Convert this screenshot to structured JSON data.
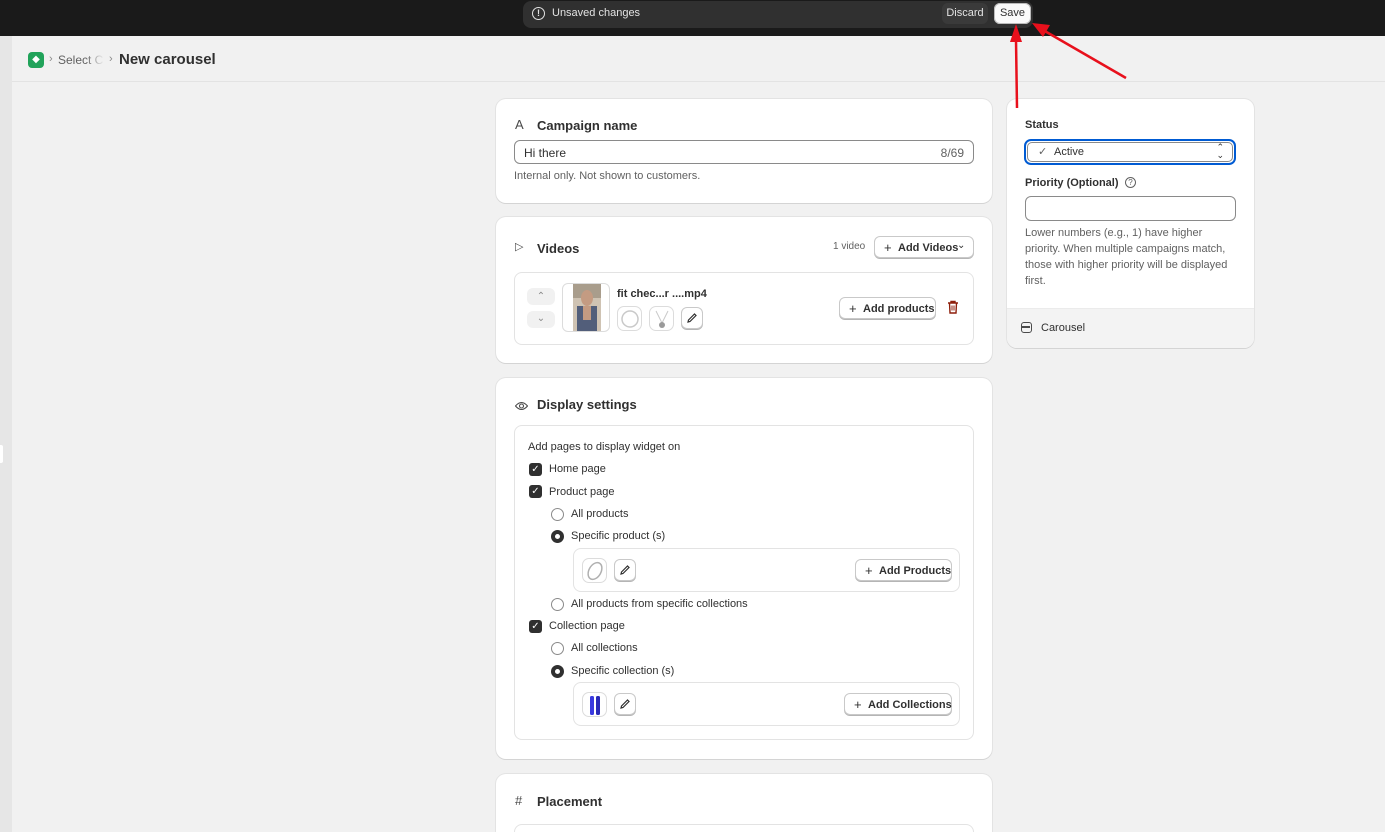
{
  "contextual_bar": {
    "message": "Unsaved changes",
    "discard_label": "Discard",
    "save_label": "Save"
  },
  "header": {
    "breadcrumb_parent": "Select C",
    "title": "New carousel"
  },
  "campaign_name": {
    "heading": "Campaign name",
    "value": "Hi there",
    "char_count": "8/69",
    "help": "Internal only. Not shown to customers."
  },
  "videos": {
    "heading": "Videos",
    "count_label": "1 video",
    "add_videos_label": "Add Videos",
    "items": [
      {
        "filename": "fit chec...r ....mp4",
        "add_products_label": "Add products"
      }
    ]
  },
  "display_settings": {
    "heading": "Display settings",
    "intro": "Add pages to display widget on",
    "home_page": "Home page",
    "product_page": "Product page",
    "all_products": "All products",
    "specific_products": "Specific product (s)",
    "add_products_label": "Add Products",
    "all_from_collections": "All products from specific collections",
    "collection_page": "Collection page",
    "all_collections": "All collections",
    "specific_collections": "Specific collection (s)",
    "add_collections_label": "Add Collections"
  },
  "placement": {
    "heading": "Placement"
  },
  "sidebar": {
    "status_label": "Status",
    "status_value": "Active",
    "priority_label": "Priority (Optional)",
    "priority_value": "",
    "priority_help": "Lower numbers (e.g., 1) have higher priority. When multiple campaigns match, those with higher priority will be displayed first.",
    "widget_type": "Carousel"
  },
  "colors": {
    "topbar": "#1a1a1a",
    "annotation_arrow": "#e8101c",
    "app_logo": "#21a35a",
    "delete_icon": "#8e1f0b",
    "status_focus": "#005bd3"
  }
}
